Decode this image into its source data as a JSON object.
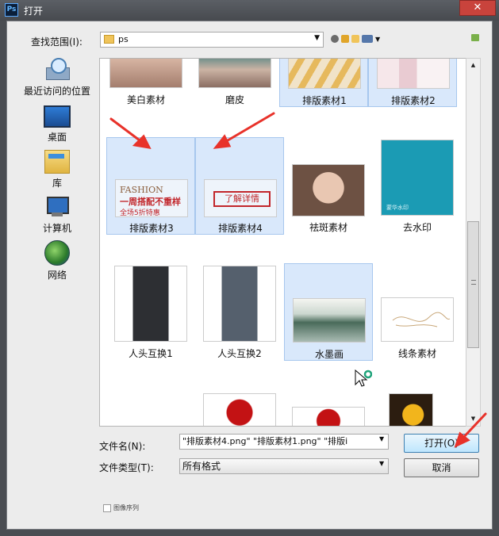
{
  "window": {
    "app_icon": "Ps",
    "title": "打开",
    "close_glyph": "✕"
  },
  "toolbar": {
    "look_in_label": "查找范围(I):",
    "look_in_value": "ps"
  },
  "places": [
    {
      "label": "最近访问的位置",
      "icon": "recent-places-icon"
    },
    {
      "label": "桌面",
      "icon": "desktop-icon"
    },
    {
      "label": "库",
      "icon": "libraries-icon"
    },
    {
      "label": "计算机",
      "icon": "computer-icon"
    },
    {
      "label": "网络",
      "icon": "network-icon"
    }
  ],
  "files": [
    {
      "name": "美白素材",
      "selected": false
    },
    {
      "name": "磨皮",
      "selected": false
    },
    {
      "name": "排版素材1",
      "selected": true
    },
    {
      "name": "排版素材2",
      "selected": true
    },
    {
      "name": "排版素材3",
      "selected": true
    },
    {
      "name": "排版素材4",
      "selected": true
    },
    {
      "name": "祛斑素材",
      "selected": false
    },
    {
      "name": "去水印",
      "selected": false
    },
    {
      "name": "人头互换1",
      "selected": false
    },
    {
      "name": "人头互换2",
      "selected": false
    },
    {
      "name": "水墨画",
      "selected": true
    },
    {
      "name": "线条素材",
      "selected": false
    }
  ],
  "thumb_text": {
    "banner3_title": "FASHION",
    "banner3_main": "一周搭配不重样",
    "banner3_sub": "全场5折特惠",
    "banner4_button": "了解详情",
    "rose_watermark": "蒙华水印"
  },
  "footer": {
    "filename_label": "文件名(N):",
    "filename_value": "\"排版素材4.png\" \"排版素材1.png\" \"排版i",
    "filetype_label": "文件类型(T):",
    "filetype_value": "所有格式",
    "open_button": "打开(O)",
    "cancel_button": "取消",
    "preview_label": "图像序列"
  },
  "colors": {
    "selection": "#d9e8fb",
    "annotation_arrow": "#e8322a",
    "title_bar": "#4f5358"
  }
}
